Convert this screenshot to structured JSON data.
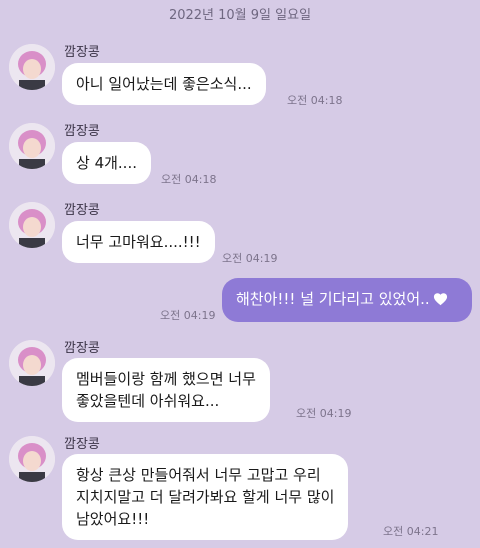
{
  "date_divider": "2022년 10월 9일 일요일",
  "messages": [
    {
      "sender": "깜장콩",
      "text": "아니 일어났는데 좋은소식...",
      "time": "오전 04:18"
    },
    {
      "sender": "깜장콩",
      "text": "상 4개....",
      "time": "오전 04:18"
    },
    {
      "sender": "깜장콩",
      "text": "너무 고마워요....!!!",
      "time": "오전 04:19"
    },
    {
      "sender": "",
      "text": "해찬아!!! 널 기다리고 있었어..",
      "time": "오전 04:19",
      "icon": "heart-icon"
    },
    {
      "sender": "깜장콩",
      "lines": [
        "멤버들이랑 함께 했으면 너무",
        "좋았을텐데 아쉬워요..."
      ],
      "time": "오전 04:19"
    },
    {
      "sender": "깜장콩",
      "lines": [
        "항상 큰상 만들어줘서 너무 고맙고 우리",
        "지치지말고 더 달려가봐요 할게 너무 많이",
        "남았어요!!!"
      ],
      "time": "오전 04:21"
    }
  ],
  "colors": {
    "background": "#d6cbe6",
    "incoming_bubble": "#ffffff",
    "outgoing_bubble": "#8e7ad6"
  }
}
